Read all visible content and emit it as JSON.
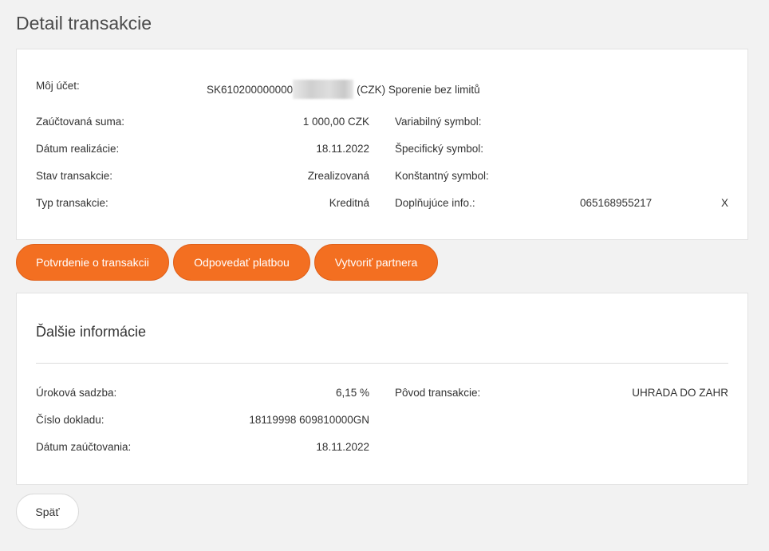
{
  "page": {
    "title": "Detail transakcie"
  },
  "account": {
    "label": "Môj účet:",
    "iban_prefix": "SK610200000000",
    "suffix": "(CZK) Sporenie bez limitů"
  },
  "details": {
    "amount": {
      "label": "Zaúčtovaná suma:",
      "value": "1 000,00 CZK"
    },
    "realization_date": {
      "label": "Dátum realizácie:",
      "value": "18.11.2022"
    },
    "status": {
      "label": "Stav transakcie:",
      "value": "Zrealizovaná"
    },
    "type": {
      "label": "Typ transakcie:",
      "value": "Kreditná"
    },
    "variable_symbol": {
      "label": "Variabilný symbol:",
      "value": ""
    },
    "specific_symbol": {
      "label": "Špecifický symbol:",
      "value": ""
    },
    "constant_symbol": {
      "label": "Konštantný symbol:",
      "value": ""
    },
    "additional_info": {
      "label": "Doplňujúce info.:",
      "value": "065168955217",
      "extra": "X"
    }
  },
  "actions": {
    "confirmation": "Potvrdenie o transakcii",
    "reply_payment": "Odpovedať platbou",
    "create_partner": "Vytvoriť partnera"
  },
  "more_info": {
    "title": "Ďalšie informácie",
    "interest_rate": {
      "label": "Úroková sadzba:",
      "value": "6,15 %"
    },
    "document_number": {
      "label": "Číslo dokladu:",
      "value": "18119998 609810000GN"
    },
    "posting_date": {
      "label": "Dátum zaúčtovania:",
      "value": "18.11.2022"
    },
    "origin": {
      "label": "Pôvod transakcie:",
      "value": "UHRADA DO ZAHR"
    }
  },
  "back_label": "Späť"
}
